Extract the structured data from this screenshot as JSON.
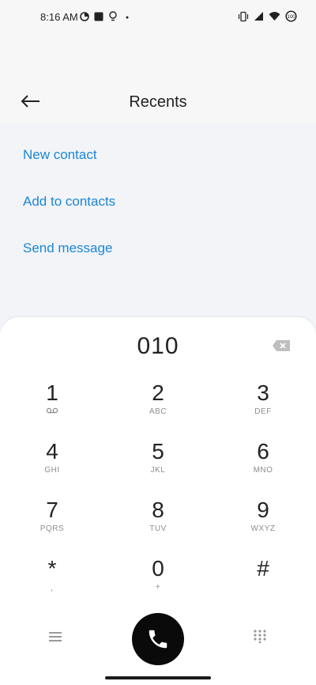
{
  "status_bar": {
    "time": "8:16 AM",
    "left_icons": [
      "data-saver-icon",
      "square-notification-icon",
      "bulb-icon",
      "dot-icon"
    ],
    "right_icons": [
      "vibrate-icon",
      "signal-icon",
      "wifi-icon",
      "battery-icon"
    ],
    "battery_level": "100"
  },
  "header": {
    "title": "Recents",
    "back_icon": "back-arrow-icon"
  },
  "actions": {
    "new_contact": "New contact",
    "add_to_contacts": "Add to contacts",
    "send_message": "Send message"
  },
  "dialpad": {
    "number": "010",
    "backspace_icon": "backspace-icon",
    "keys": [
      {
        "digit": "1",
        "letters": "",
        "sub_icon": "voicemail-icon"
      },
      {
        "digit": "2",
        "letters": "ABC"
      },
      {
        "digit": "3",
        "letters": "DEF"
      },
      {
        "digit": "4",
        "letters": "GHI"
      },
      {
        "digit": "5",
        "letters": "JKL"
      },
      {
        "digit": "6",
        "letters": "MNO"
      },
      {
        "digit": "7",
        "letters": "PQRS"
      },
      {
        "digit": "8",
        "letters": "TUV"
      },
      {
        "digit": "9",
        "letters": "WXYZ"
      },
      {
        "digit": "*",
        "letters": "⸴"
      },
      {
        "digit": "0",
        "letters": "+"
      },
      {
        "digit": "#",
        "letters": ""
      }
    ]
  },
  "bottom_bar": {
    "menu_icon": "menu-icon",
    "call_icon": "phone-icon",
    "keypad_icon": "keypad-icon"
  },
  "colors": {
    "accent": "#1c86d6",
    "call_button": "#0a0a0a",
    "background": "#f2f4f7"
  }
}
